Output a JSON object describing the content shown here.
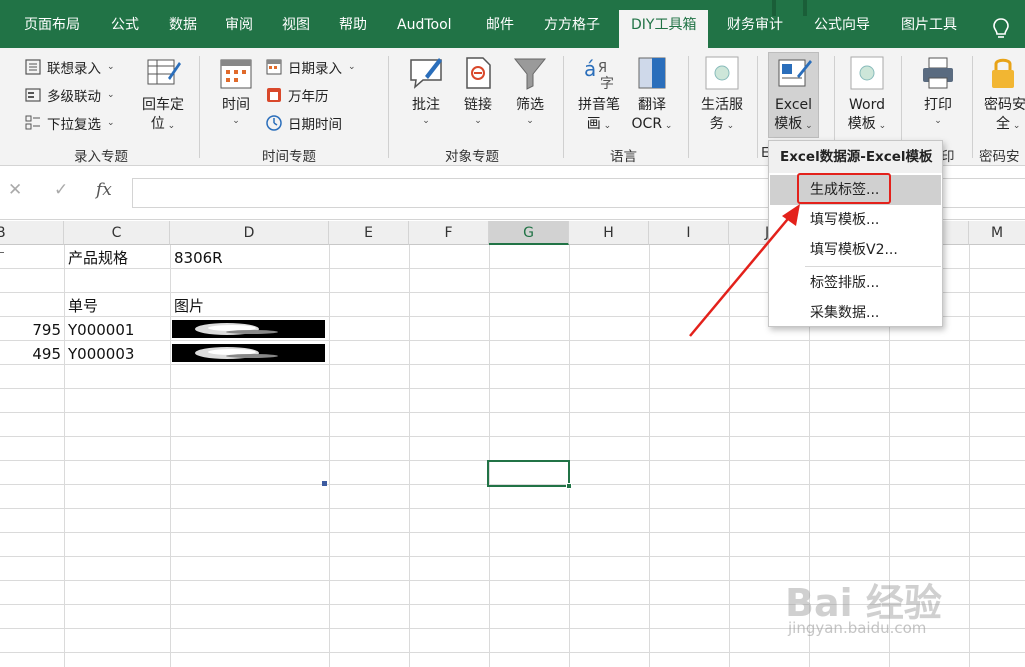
{
  "tabs": [
    {
      "label": "页面布局",
      "active": false
    },
    {
      "label": "公式",
      "active": false
    },
    {
      "label": "数据",
      "active": false
    },
    {
      "label": "审阅",
      "active": false
    },
    {
      "label": "视图",
      "active": false
    },
    {
      "label": "帮助",
      "active": false
    },
    {
      "label": "AudTool",
      "active": false
    },
    {
      "label": "邮件",
      "active": false
    },
    {
      "label": "方方格子",
      "active": false
    },
    {
      "label": "DIY工具箱",
      "active": true
    },
    {
      "label": "财务审计",
      "active": false
    },
    {
      "label": "公式向导",
      "active": false
    },
    {
      "label": "图片工具",
      "active": false
    }
  ],
  "ribbon": {
    "input_group": {
      "items": [
        "联想录入",
        "多级联动",
        "下拉复选"
      ],
      "big_button": {
        "line1": "回车定",
        "line2": "位"
      },
      "label": "录入专题"
    },
    "time_group": {
      "big_button": "时间",
      "items": [
        "日期录入",
        "万年历",
        "日期时间"
      ],
      "label": "时间专题"
    },
    "object_group": {
      "buttons": [
        "批注",
        "链接",
        "筛选"
      ],
      "label": "对象专题"
    },
    "language_group": {
      "buttons": [
        {
          "line1": "拼音笔",
          "line2": "画"
        },
        {
          "line1": "翻译",
          "line2": "OCR"
        }
      ],
      "label": "语言"
    },
    "life_service": {
      "line1": "生活服",
      "line2": "务"
    },
    "excel_template": {
      "line1": "Excel",
      "line2": "模板"
    },
    "word_template": {
      "line1": "Word",
      "line2": "模板"
    },
    "print": "打印",
    "password": {
      "line1": "密码安",
      "line2": "全"
    },
    "group_label_partial_left": "E",
    "group_label_partial_print": "印",
    "group_label_password": "密码安"
  },
  "formula_bar": {
    "cancel": "✕",
    "enter": "✓",
    "fx": "fx",
    "value": ""
  },
  "columns": [
    "B",
    "C",
    "D",
    "E",
    "F",
    "G",
    "H",
    "I",
    "J",
    "M"
  ],
  "selected_column": "G",
  "cells": {
    "c1": "产品规格",
    "d1": "8306R",
    "c3": "单号",
    "d3": "图片",
    "b4": "795",
    "c4": "Y000001",
    "b5": "495",
    "c5": "Y000003"
  },
  "dropdown": {
    "header": "Excel数据源-Excel模板",
    "items": [
      "生成标签...",
      "填写模板...",
      "填写模板V2...",
      "标签排版...",
      "采集数据..."
    ],
    "highlighted": "生成标签..."
  },
  "watermark": {
    "brand": "Bai 经验",
    "url": "jingyan.baidu.com"
  },
  "colors": {
    "accent": "#217346",
    "highlight_box": "#e3211b",
    "arrow": "#e3211b"
  }
}
